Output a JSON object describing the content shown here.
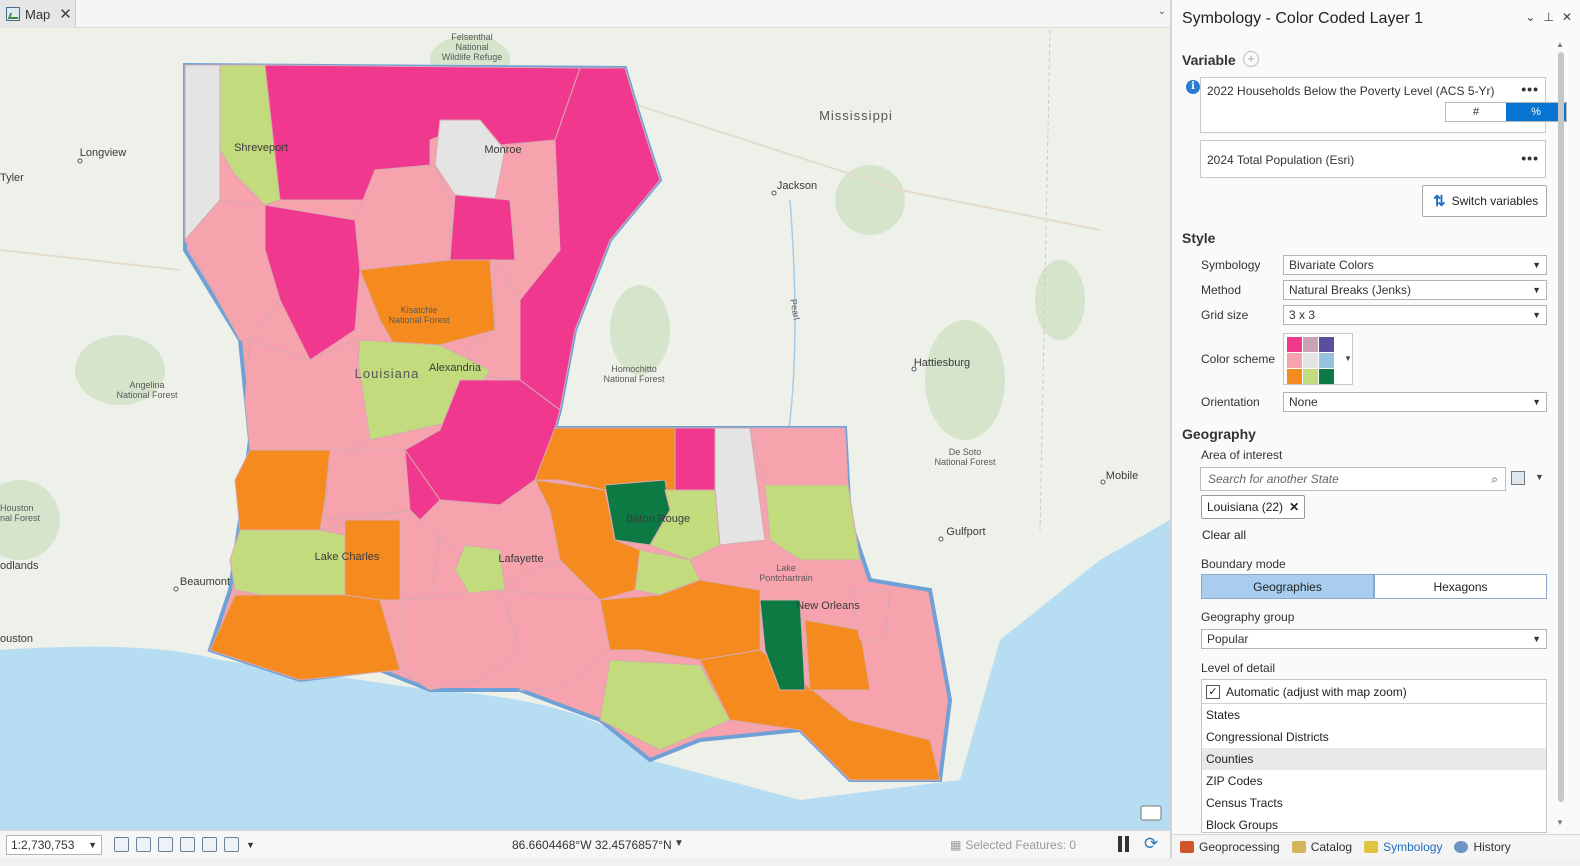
{
  "map_tab": {
    "label": "Map",
    "close": "✕",
    "dropdown": "⌄"
  },
  "map": {
    "labels": {
      "felsenthal": [
        "Felsenthal",
        "National",
        "Wildlife Refuge"
      ],
      "mississippi": "Mississippi",
      "longview": "Longview",
      "tyler": "Tyler",
      "jackson": "Jackson",
      "shreveport": "Shreveport",
      "monroe": "Monroe",
      "pearl": "Pearl",
      "kisatchie": [
        "Kisatchie",
        "National Forest"
      ],
      "louisiana": "Louisiana",
      "alexandria": "Alexandria",
      "homochitto": [
        "Homochitto",
        "National Forest"
      ],
      "hattiesburg": "Hattiesburg",
      "angelina": [
        "Angelina",
        "National Forest"
      ],
      "desoto": [
        "De Soto",
        "National Forest"
      ],
      "mobile": "Mobile",
      "houston_nf": [
        "Houston",
        "nal Forest"
      ],
      "baton_rouge": "Baton Rouge",
      "gulfport": "Gulfport",
      "woodlands": "odlands",
      "beaumont": "Beaumont",
      "lake_charles": "Lake Charles",
      "lafayette": "Lafayette",
      "lake_pont": [
        "Lake",
        "Pontchartrain"
      ],
      "new_orleans": "New Orleans",
      "houston": "ouston"
    }
  },
  "statusbar": {
    "scale": "1:2,730,753",
    "coords": "86.6604468°W 32.4576857°N",
    "selected_features": "Selected Features: 0"
  },
  "symbology": {
    "title": "Symbology - Color Coded Layer 1",
    "header_controls": [
      "⌄",
      "⊥",
      "✕"
    ],
    "variable_section": "Variable",
    "variable_add": "+",
    "variable_1": "2022 Households Below the Poverty Level (ACS 5-Yr)",
    "toggle_count": "#",
    "toggle_percent": "%",
    "variable_2": "2024 Total Population (Esri)",
    "menu_dots": "•••",
    "switch_variables": "Switch variables",
    "style_section": "Style",
    "symbology_label": "Symbology",
    "symbology_value": "Bivariate Colors",
    "method_label": "Method",
    "method_value": "Natural Breaks (Jenks)",
    "grid_label": "Grid size",
    "grid_value": "3 x 3",
    "color_scheme_label": "Color scheme",
    "color_scheme": [
      "#f0388f",
      "#c9a2b6",
      "#5a4f9e",
      "#f6a3ad",
      "#e4e4e4",
      "#95c3dd",
      "#f58a1f",
      "#c2db7c",
      "#0e7a43"
    ],
    "orientation_label": "Orientation",
    "orientation_value": "None",
    "geography_section": "Geography",
    "aoi_label": "Area of interest",
    "aoi_placeholder": "Search for another State",
    "aoi_chip": "Louisiana (22)",
    "clear_all": "Clear all",
    "boundary_label": "Boundary mode",
    "boundary_geographies": "Geographies",
    "boundary_hexagons": "Hexagons",
    "group_label": "Geography group",
    "group_value": "Popular",
    "lod_label": "Level of detail",
    "lod_auto": "Automatic (adjust with map zoom)",
    "lod_items": [
      "States",
      "Congressional Districts",
      "Counties",
      "ZIP Codes",
      "Census Tracts",
      "Block Groups"
    ]
  },
  "bottom_tabs": [
    "Geoprocessing",
    "Catalog",
    "Symbology",
    "History"
  ],
  "colors": {
    "accent": "#0874d1",
    "pink": "#f0388f",
    "light_pink": "#f6a3ad",
    "gray": "#e4e4e4",
    "orange": "#f58a1f",
    "light_green": "#c2db7c",
    "green": "#0e7a43",
    "water": "#b7ddf2",
    "boundary": "#6fa1d6"
  }
}
